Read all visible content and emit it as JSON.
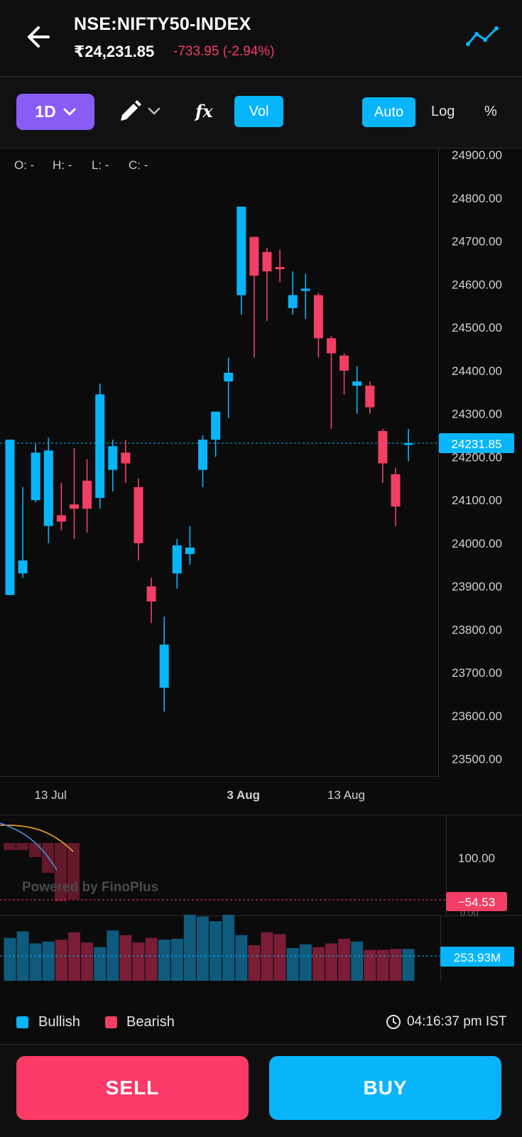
{
  "header": {
    "symbol": "NSE:NIFTY50-INDEX",
    "price": "₹24,231.85",
    "change": "-733.95 (-2.94%)",
    "icons": {
      "back": "arrow-left-icon",
      "chart_type": "line-chart-icon"
    }
  },
  "toolbar": {
    "timeframe": "1D",
    "fx_label": "fx",
    "vol_label": "Vol",
    "auto_label": "Auto",
    "log_label": "Log",
    "pct_label": "%",
    "icons": {
      "draw": "pencil-icon",
      "dropdown": "chevron-down-icon"
    }
  },
  "ohlc": {
    "o": "O: -",
    "h": "H: -",
    "l": "L: -",
    "c": "C: -"
  },
  "watermark": "Powered by FinoPlus",
  "indicator": {
    "tick": "100.00",
    "badge": "−54.53",
    "cut_tick": "0.00"
  },
  "volume": {
    "badge": "253.93M"
  },
  "legend": {
    "bullish": "Bullish",
    "bearish": "Bearish"
  },
  "clock": {
    "time": "04:16:37 pm IST",
    "icon": "clock-icon"
  },
  "actions": {
    "sell": "SELL",
    "buy": "BUY"
  },
  "colors": {
    "bull": "#08b5fb",
    "bear": "#f23f65",
    "accent": "#8a5cf6",
    "sell": "#fc3a68",
    "buy": "#08b5fb"
  },
  "chart_data": {
    "type": "candlestick",
    "ylim": [
      23460,
      24915
    ],
    "yticks": [
      24900,
      24800,
      24700,
      24600,
      24500,
      24400,
      24300,
      24200,
      24100,
      24000,
      23900,
      23800,
      23700,
      23600,
      23500
    ],
    "ytick_labels": [
      "24900.00",
      "24800.00",
      "24700.00",
      "24600.00",
      "24500.00",
      "24400.00",
      "24300.00",
      "24200.00",
      "24100.00",
      "24000.00",
      "23900.00",
      "23800.00",
      "23700.00",
      "23600.00",
      "23500.00"
    ],
    "last_price": 24231.85,
    "last_price_label": "24231.85",
    "xticks": [
      {
        "index": 2,
        "label": "13 Jul",
        "bold": false
      },
      {
        "index": 17,
        "label": "3 Aug",
        "bold": true
      },
      {
        "index": 25,
        "label": "13 Aug",
        "bold": false
      }
    ],
    "candles": [
      {
        "o": 23880,
        "h": 24240,
        "l": 23880,
        "c": 24240
      },
      {
        "o": 23930,
        "h": 24130,
        "l": 23920,
        "c": 23960
      },
      {
        "o": 24100,
        "h": 24230,
        "l": 24095,
        "c": 24210
      },
      {
        "o": 24040,
        "h": 24245,
        "l": 24000,
        "c": 24215
      },
      {
        "o": 24065,
        "h": 24140,
        "l": 24030,
        "c": 24050
      },
      {
        "o": 24090,
        "h": 24220,
        "l": 24010,
        "c": 24080
      },
      {
        "o": 24145,
        "h": 24195,
        "l": 24025,
        "c": 24080
      },
      {
        "o": 24105,
        "h": 24370,
        "l": 24080,
        "c": 24345
      },
      {
        "o": 24170,
        "h": 24240,
        "l": 24120,
        "c": 24225
      },
      {
        "o": 24210,
        "h": 24240,
        "l": 24140,
        "c": 24185
      },
      {
        "o": 24130,
        "h": 24150,
        "l": 23960,
        "c": 24000
      },
      {
        "o": 23900,
        "h": 23920,
        "l": 23815,
        "c": 23865
      },
      {
        "o": 23665,
        "h": 23830,
        "l": 23610,
        "c": 23765
      },
      {
        "o": 23930,
        "h": 24010,
        "l": 23895,
        "c": 23995
      },
      {
        "o": 23975,
        "h": 24040,
        "l": 23950,
        "c": 23990
      },
      {
        "o": 24170,
        "h": 24250,
        "l": 24130,
        "c": 24240
      },
      {
        "o": 24240,
        "h": 24280,
        "l": 24200,
        "c": 24305
      },
      {
        "o": 24375,
        "h": 24430,
        "l": 24290,
        "c": 24395
      },
      {
        "o": 24575,
        "h": 24780,
        "l": 24530,
        "c": 24780
      },
      {
        "o": 24710,
        "h": 24710,
        "l": 24430,
        "c": 24620
      },
      {
        "o": 24675,
        "h": 24685,
        "l": 24515,
        "c": 24630
      },
      {
        "o": 24640,
        "h": 24680,
        "l": 24605,
        "c": 24635
      },
      {
        "o": 24545,
        "h": 24630,
        "l": 24530,
        "c": 24575
      },
      {
        "o": 24585,
        "h": 24625,
        "l": 24520,
        "c": 24590
      },
      {
        "o": 24575,
        "h": 24580,
        "l": 24430,
        "c": 24475
      },
      {
        "o": 24475,
        "h": 24480,
        "l": 24265,
        "c": 24440
      },
      {
        "o": 24435,
        "h": 24440,
        "l": 24345,
        "c": 24400
      },
      {
        "o": 24365,
        "h": 24410,
        "l": 24300,
        "c": 24375
      },
      {
        "o": 24365,
        "h": 24375,
        "l": 24300,
        "c": 24315
      },
      {
        "o": 24260,
        "h": 24265,
        "l": 24140,
        "c": 24185
      },
      {
        "o": 24160,
        "h": 24175,
        "l": 24040,
        "c": 24085
      },
      {
        "o": 24230,
        "h": 24265,
        "l": 24190,
        "c": 24232
      }
    ],
    "volume_relative": [
      0.68,
      0.75,
      0.62,
      0.64,
      0.66,
      0.74,
      0.63,
      0.58,
      0.76,
      0.71,
      0.63,
      0.68,
      0.66,
      0.67,
      0.93,
      0.91,
      0.86,
      0.93,
      0.71,
      0.6,
      0.74,
      0.72,
      0.57,
      0.61,
      0.58,
      0.62,
      0.67,
      0.64,
      0.55,
      0.55,
      0.56,
      0.56
    ]
  }
}
